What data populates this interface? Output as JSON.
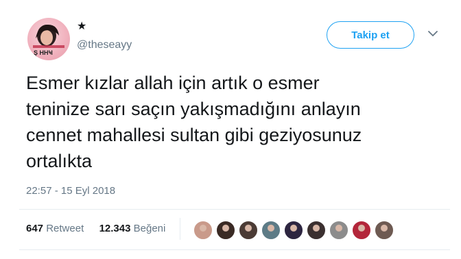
{
  "user": {
    "display_name": "★",
    "handle": "@theseayy",
    "avatar_icon": "profile-photo"
  },
  "follow_button": {
    "label": "Takip et"
  },
  "menu": {
    "icon": "chevron-down-icon"
  },
  "tweet": {
    "lines": [
      "Esmer kızlar allah için artık o esmer",
      "teninize sarı saçın yakışmadığını anlayın",
      "cennet mahallesi sultan gibi geziyosunuz",
      "ortalıkta"
    ],
    "timestamp": "22:57 - 15 Eyl 2018"
  },
  "stats": {
    "retweets_count": "647",
    "retweets_label": "Retweet",
    "likes_count": "12.343",
    "likes_label": "Beğeni"
  },
  "likers": [
    {
      "color": "#c99a8a"
    },
    {
      "color": "#3a2a24"
    },
    {
      "color": "#4b3b35"
    },
    {
      "color": "#5d7b86"
    },
    {
      "color": "#2d2540"
    },
    {
      "color": "#3b3030"
    },
    {
      "color": "#8c8c8c"
    },
    {
      "color": "#b3263a"
    },
    {
      "color": "#6e5a52"
    }
  ],
  "colors": {
    "accent": "#1da1f2",
    "text": "#14171a",
    "muted": "#657786",
    "border": "#e6ecf0"
  }
}
